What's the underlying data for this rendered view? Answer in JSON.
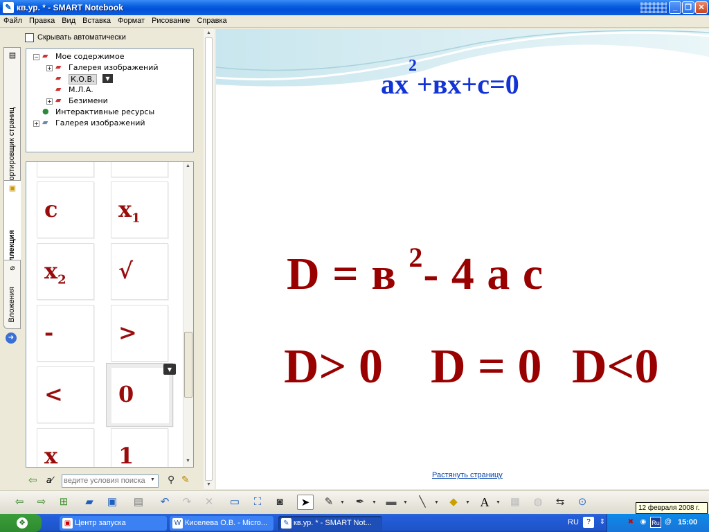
{
  "window": {
    "title": "кв.ур. * - SMART Notebook"
  },
  "menu": [
    "Файл",
    "Правка",
    "Вид",
    "Вставка",
    "Формат",
    "Рисование",
    "Справка"
  ],
  "side_tabs": {
    "sorter": "Сортировщик страниц",
    "collection": "Коллекция",
    "attachments": "Вложения"
  },
  "panel": {
    "autohide": "Скрывать автоматически",
    "tree": [
      {
        "label": "Мое содержимое",
        "expander": "−"
      },
      {
        "label": "Галерея изображений",
        "expander": "+"
      },
      {
        "label": "К.О.В.",
        "expander": ""
      },
      {
        "label": "М.Л.А.",
        "expander": ""
      },
      {
        "label": "Безимени",
        "expander": "+"
      },
      {
        "label": "Интерактивные ресурсы",
        "expander": ""
      },
      {
        "label": "Галерея изображений",
        "expander": "+"
      }
    ],
    "tiles": [
      {
        "main": "c",
        "sub": ""
      },
      {
        "main": "x",
        "sub": "1"
      },
      {
        "main": "x",
        "sub": "2"
      },
      {
        "main": "√",
        "sub": ""
      },
      {
        "main": "-",
        "sub": ""
      },
      {
        "main": ">",
        "sub": ""
      },
      {
        "main": "<",
        "sub": ""
      },
      {
        "main": "0",
        "sub": ""
      },
      {
        "main": "x",
        "sub": ""
      },
      {
        "main": "1",
        "sub": ""
      }
    ],
    "search_placeholder": "ведите условия поиска"
  },
  "page": {
    "eq_quadratic": {
      "a": "ax",
      "exp": "2",
      "rest": "+вх+с=0"
    },
    "discriminant": {
      "lhs": "D = в ",
      "exp": "2",
      "rhs": "- 4 а с"
    },
    "cases": [
      "D> 0",
      "D = 0",
      "D<0"
    ],
    "stretch_link": "Растянуть страницу"
  },
  "tooltip": "12 февраля 2008 г.",
  "taskbar": {
    "tasks": [
      "Центр запуска",
      "Киселева О.В. - Micro...",
      "кв.ур. * - SMART Not..."
    ],
    "lang": "RU",
    "time": "15:00"
  },
  "colors": {
    "equation_blue": "#1233d6",
    "formula_red": "#990000"
  }
}
